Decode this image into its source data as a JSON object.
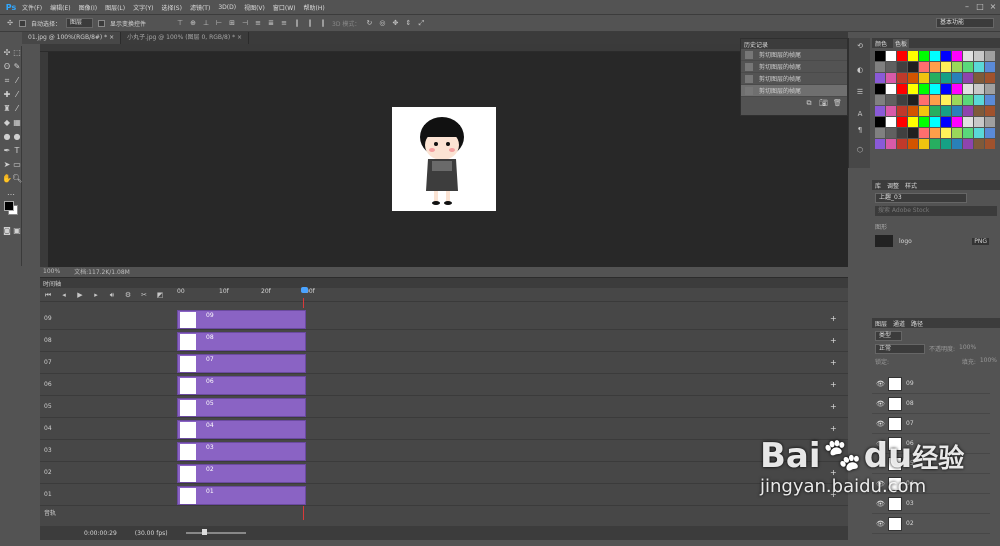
{
  "app": {
    "logo": "Ps"
  },
  "menu": [
    "文件(F)",
    "编辑(E)",
    "图像(I)",
    "图层(L)",
    "文字(Y)",
    "选择(S)",
    "滤镜(T)",
    "3D(D)",
    "视图(V)",
    "窗口(W)",
    "帮助(H)"
  ],
  "options": {
    "auto_select_label": "自动选择：",
    "auto_select_value": "图层",
    "show_transform_label": "显示变换控件",
    "mode_3d": "3D 模式：",
    "workspace": "基本功能"
  },
  "tabs": [
    "01.jpg @ 100%(RGB/8#) * ×",
    "小丸子.jpg @ 100% (图层 0, RGB/8) * ×"
  ],
  "status": {
    "zoom": "100%",
    "doc": "文档:117.2K/1.08M"
  },
  "history": {
    "title": "历史记录",
    "items": [
      "剪切图层的帧尾",
      "剪切图层的帧尾",
      "剪切图层的帧尾",
      "剪切图层的帧尾"
    ]
  },
  "timeline": {
    "title": "时间轴",
    "ruler": [
      "00",
      "10f",
      "20f",
      "00f"
    ],
    "tracks": [
      "09",
      "08",
      "07",
      "06",
      "05",
      "04",
      "03",
      "02",
      "01"
    ],
    "audio_label": "音轨",
    "time": "0:00:00:29",
    "fps": "(30.00 fps)"
  },
  "swatch_tabs": [
    "颜色",
    "色板"
  ],
  "swatch_colors": [
    "#000000",
    "#ffffff",
    "#ff0000",
    "#ffff00",
    "#00ff00",
    "#00ffff",
    "#0000ff",
    "#ff00ff",
    "#e0e0e0",
    "#c8c8c8",
    "#a0a0a0",
    "#808080",
    "#606060",
    "#404040",
    "#202020",
    "#ff6e6e",
    "#ff9e4a",
    "#fff15a",
    "#9ad85a",
    "#5ad87a",
    "#5ad8d8",
    "#5a8ad8",
    "#8a5ad8",
    "#d85aa8",
    "#c0392b",
    "#d35400",
    "#f1c40f",
    "#27ae60",
    "#16a085",
    "#2980b9",
    "#8e44ad",
    "#7f5a3a",
    "#a0522d"
  ],
  "libraries": {
    "tabs": [
      "库",
      "调整",
      "样式"
    ],
    "library_name": "上趣_03",
    "search": "搜索 Adobe Stock",
    "section": "图形",
    "item": "logo",
    "badge": "PNG"
  },
  "layers": {
    "tabs": [
      "图层",
      "通道",
      "路径"
    ],
    "kind": "类型",
    "blend": "正常",
    "opacity_label": "不透明度:",
    "opacity": "100%",
    "lock_label": "锁定:",
    "fill_label": "填充:",
    "fill": "100%",
    "rows": [
      "09",
      "08",
      "07",
      "06",
      "05",
      "04",
      "03",
      "02"
    ]
  },
  "watermark": {
    "brand": "Bai",
    "paw": "du",
    "cn": "经验",
    "url": "jingyan.baidu.com"
  }
}
